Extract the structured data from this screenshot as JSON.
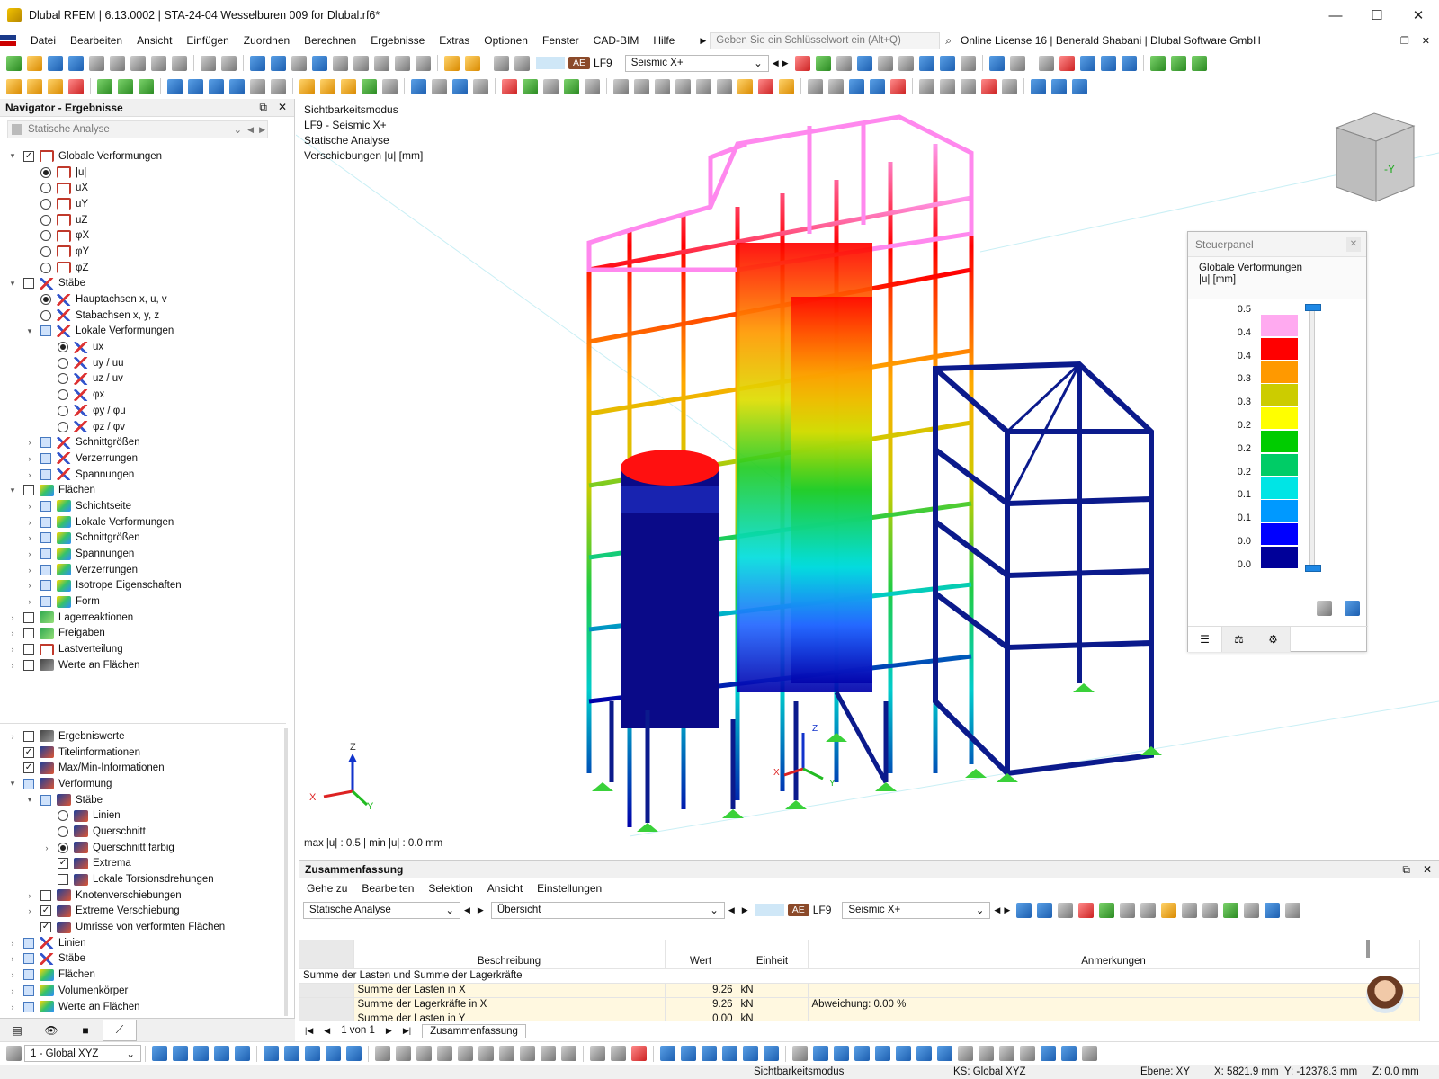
{
  "window": {
    "title": "Dlubal RFEM | 6.13.0002 | STA-24-04 Wesselburen 009 for Dlubal.rf6*"
  },
  "menu": {
    "items": [
      "Datei",
      "Bearbeiten",
      "Ansicht",
      "Einfügen",
      "Zuordnen",
      "Berechnen",
      "Ergebnisse",
      "Extras",
      "Optionen",
      "Fenster",
      "CAD-BIM",
      "Hilfe"
    ],
    "search_placeholder": "Geben Sie ein Schlüsselwort ein (Alt+Q)",
    "license": "Online License 16 | Benerald Shabani | Dlubal Software GmbH"
  },
  "toolbar": {
    "ae_badge": "AE",
    "lf_label": "LF9",
    "loadcase": "Seismic X+"
  },
  "navigator": {
    "title": "Navigator - Ergebnisse",
    "analysis": "Statische Analyse",
    "tree": [
      {
        "exp": "v",
        "box": "chk",
        "checked": true,
        "icon": "def",
        "label": "Globale Verformungen",
        "level": 0
      },
      {
        "exp": "",
        "box": "rad",
        "checked": true,
        "icon": "def",
        "label": "|u|",
        "level": 1
      },
      {
        "exp": "",
        "box": "rad",
        "checked": false,
        "icon": "def",
        "label": "uX",
        "level": 1
      },
      {
        "exp": "",
        "box": "rad",
        "checked": false,
        "icon": "def",
        "label": "uY",
        "level": 1
      },
      {
        "exp": "",
        "box": "rad",
        "checked": false,
        "icon": "def",
        "label": "uZ",
        "level": 1
      },
      {
        "exp": "",
        "box": "rad",
        "checked": false,
        "icon": "def",
        "label": "φX",
        "level": 1
      },
      {
        "exp": "",
        "box": "rad",
        "checked": false,
        "icon": "def",
        "label": "φY",
        "level": 1
      },
      {
        "exp": "",
        "box": "rad",
        "checked": false,
        "icon": "def",
        "label": "φZ",
        "level": 1
      },
      {
        "exp": "v",
        "box": "chk",
        "checked": false,
        "icon": "mem",
        "label": "Stäbe",
        "level": 0
      },
      {
        "exp": "",
        "box": "rad",
        "checked": true,
        "icon": "mem",
        "label": "Hauptachsen x, u, v",
        "level": 1
      },
      {
        "exp": "",
        "box": "rad",
        "checked": false,
        "icon": "mem",
        "label": "Stabachsen x, y, z",
        "level": 1
      },
      {
        "exp": "v",
        "box": "part",
        "checked": false,
        "icon": "mem",
        "label": "Lokale Verformungen",
        "level": 1
      },
      {
        "exp": "",
        "box": "rad",
        "checked": true,
        "icon": "mem",
        "label": "ux",
        "level": 2
      },
      {
        "exp": "",
        "box": "rad",
        "checked": false,
        "icon": "mem",
        "label": "uy / uu",
        "level": 2
      },
      {
        "exp": "",
        "box": "rad",
        "checked": false,
        "icon": "mem",
        "label": "uz / uv",
        "level": 2
      },
      {
        "exp": "",
        "box": "rad",
        "checked": false,
        "icon": "mem",
        "label": "φx",
        "level": 2
      },
      {
        "exp": "",
        "box": "rad",
        "checked": false,
        "icon": "mem",
        "label": "φy / φu",
        "level": 2
      },
      {
        "exp": "",
        "box": "rad",
        "checked": false,
        "icon": "mem",
        "label": "φz / φv",
        "level": 2
      },
      {
        "exp": ">",
        "box": "part",
        "checked": false,
        "icon": "mem",
        "label": "Schnittgrößen",
        "level": 1
      },
      {
        "exp": ">",
        "box": "part",
        "checked": false,
        "icon": "mem",
        "label": "Verzerrungen",
        "level": 1
      },
      {
        "exp": ">",
        "box": "part",
        "checked": false,
        "icon": "mem",
        "label": "Spannungen",
        "level": 1
      },
      {
        "exp": "v",
        "box": "chk",
        "checked": false,
        "icon": "surf",
        "label": "Flächen",
        "level": 0
      },
      {
        "exp": ">",
        "box": "part",
        "checked": false,
        "icon": "surf",
        "label": "Schichtseite",
        "level": 1
      },
      {
        "exp": ">",
        "box": "part",
        "checked": false,
        "icon": "surf",
        "label": "Lokale Verformungen",
        "level": 1
      },
      {
        "exp": ">",
        "box": "part",
        "checked": false,
        "icon": "surf",
        "label": "Schnittgrößen",
        "level": 1
      },
      {
        "exp": ">",
        "box": "part",
        "checked": false,
        "icon": "surf",
        "label": "Spannungen",
        "level": 1
      },
      {
        "exp": ">",
        "box": "part",
        "checked": false,
        "icon": "surf",
        "label": "Verzerrungen",
        "level": 1
      },
      {
        "exp": ">",
        "box": "part",
        "checked": false,
        "icon": "surf",
        "label": "Isotrope Eigenschaften",
        "level": 1
      },
      {
        "exp": ">",
        "box": "part",
        "checked": false,
        "icon": "surf",
        "label": "Form",
        "level": 1
      },
      {
        "exp": ">",
        "box": "chk",
        "checked": false,
        "icon": "lager",
        "label": "Lagerreaktionen",
        "level": 0
      },
      {
        "exp": ">",
        "box": "chk",
        "checked": false,
        "icon": "lager",
        "label": "Freigaben",
        "level": 0
      },
      {
        "exp": ">",
        "box": "chk",
        "checked": false,
        "icon": "def",
        "label": "Lastverteilung",
        "level": 0
      },
      {
        "exp": ">",
        "box": "chk",
        "checked": false,
        "icon": "misc",
        "label": "Werte an Flächen",
        "level": 0
      }
    ],
    "tree2": [
      {
        "exp": ">",
        "box": "chk",
        "checked": false,
        "icon": "misc",
        "label": "Ergebniswerte",
        "level": 0
      },
      {
        "exp": "",
        "box": "chk",
        "checked": true,
        "icon": "disp",
        "label": "Titelinformationen",
        "level": 0
      },
      {
        "exp": "",
        "box": "chk",
        "checked": true,
        "icon": "disp",
        "label": "Max/Min-Informationen",
        "level": 0
      },
      {
        "exp": "v",
        "box": "part",
        "checked": false,
        "icon": "disp",
        "label": "Verformung",
        "level": 0
      },
      {
        "exp": "v",
        "box": "part",
        "checked": false,
        "icon": "disp",
        "label": "Stäbe",
        "level": 1
      },
      {
        "exp": "",
        "box": "rad",
        "checked": false,
        "icon": "disp",
        "label": "Linien",
        "level": 2
      },
      {
        "exp": "",
        "box": "rad",
        "checked": false,
        "icon": "disp",
        "label": "Querschnitt",
        "level": 2
      },
      {
        "exp": ">",
        "box": "rad",
        "checked": true,
        "icon": "disp",
        "label": "Querschnitt farbig",
        "level": 2
      },
      {
        "exp": "",
        "box": "chk",
        "checked": true,
        "icon": "disp",
        "label": "Extrema",
        "level": 2
      },
      {
        "exp": "",
        "box": "chk",
        "checked": false,
        "icon": "disp",
        "label": "Lokale Torsionsdrehungen",
        "level": 2
      },
      {
        "exp": ">",
        "box": "chk",
        "checked": false,
        "icon": "disp",
        "label": "Knotenverschiebungen",
        "level": 1
      },
      {
        "exp": ">",
        "box": "chk",
        "checked": true,
        "icon": "disp",
        "label": "Extreme Verschiebung",
        "level": 1
      },
      {
        "exp": "",
        "box": "chk",
        "checked": true,
        "icon": "disp",
        "label": "Umrisse von verformten Flächen",
        "level": 1
      },
      {
        "exp": ">",
        "box": "part",
        "checked": false,
        "icon": "mem",
        "label": "Linien",
        "level": 0
      },
      {
        "exp": ">",
        "box": "part",
        "checked": false,
        "icon": "mem",
        "label": "Stäbe",
        "level": 0
      },
      {
        "exp": ">",
        "box": "part",
        "checked": false,
        "icon": "surf",
        "label": "Flächen",
        "level": 0
      },
      {
        "exp": ">",
        "box": "part",
        "checked": false,
        "icon": "surf",
        "label": "Volumenkörper",
        "level": 0
      },
      {
        "exp": ">",
        "box": "part",
        "checked": false,
        "icon": "surf",
        "label": "Werte an Flächen",
        "level": 0
      }
    ]
  },
  "view": {
    "info": [
      "Sichtbarkeitsmodus",
      "LF9 - Seismic X+",
      "Statische Analyse",
      "Verschiebungen |u| [mm]"
    ],
    "maxmin": "max |u| : 0.5 | min |u| : 0.0 mm",
    "axis_labels": {
      "x": "X",
      "y": "Y",
      "z": "Z"
    },
    "cube_label": "-Y"
  },
  "control_panel": {
    "title": "Steuerpanel",
    "heading": "Globale Verformungen",
    "unit": "|u| [mm]",
    "legend_values": [
      "0.5",
      "0.4",
      "0.4",
      "0.3",
      "0.3",
      "0.2",
      "0.2",
      "0.2",
      "0.1",
      "0.1",
      "0.0",
      "0.0"
    ],
    "legend_colors": [
      "#ffaaf0",
      "#ff0000",
      "#ff9900",
      "#cccc00",
      "#ffff00",
      "#00cc00",
      "#00cc66",
      "#00e5e5",
      "#0099ff",
      "#0000ff",
      "#000099"
    ]
  },
  "summary": {
    "title": "Zusammenfassung",
    "menu": [
      "Gehe zu",
      "Bearbeiten",
      "Selektion",
      "Ansicht",
      "Einstellungen"
    ],
    "analysis": "Statische Analyse",
    "overview": "Übersicht",
    "ae_badge": "AE",
    "lf_label": "LF9",
    "loadcase": "Seismic X+",
    "columns": [
      "Beschreibung",
      "Wert",
      "Einheit",
      "Anmerkungen"
    ],
    "group": "Summe der Lasten und Summe der Lagerkräfte",
    "rows": [
      {
        "desc": "Summe der Lasten in X",
        "value": "9.26",
        "unit": "kN",
        "note": ""
      },
      {
        "desc": "Summe der Lagerkräfte in X",
        "value": "9.26",
        "unit": "kN",
        "note": "Abweichung: 0.00 %"
      },
      {
        "desc": "Summe der Lasten in Y",
        "value": "0.00",
        "unit": "kN",
        "note": ""
      }
    ],
    "pager": "1 von 1",
    "tab": "Zusammenfassung"
  },
  "bottom_toolbar": {
    "coord_system": "1 - Global XYZ"
  },
  "status": {
    "mode": "Sichtbarkeitsmodus",
    "ks": "KS: Global XYZ",
    "plane": "Ebene: XY",
    "x": "X: 5821.9 mm",
    "y": "Y: -12378.3 mm",
    "z": "Z: 0.0 mm"
  }
}
